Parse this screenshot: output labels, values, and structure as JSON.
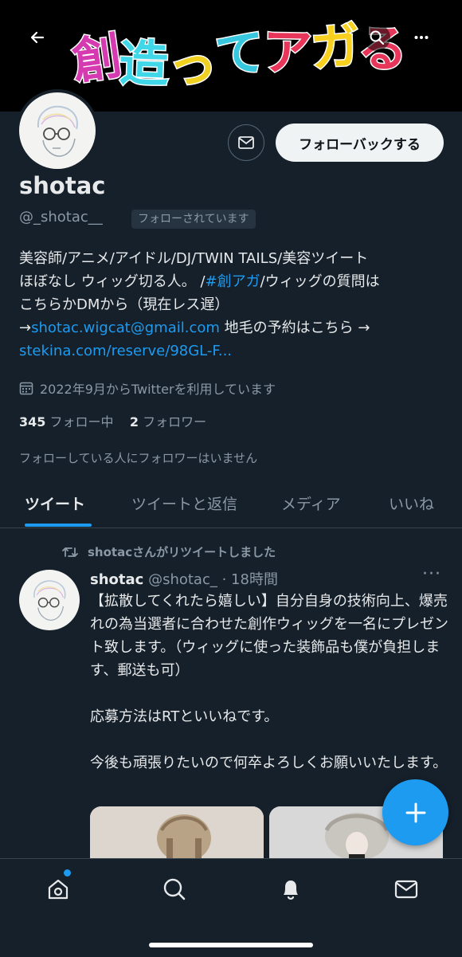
{
  "banner": {
    "title_glyphs": [
      "創",
      "造",
      "っ",
      "て",
      "ア",
      "ガ",
      "る"
    ]
  },
  "profile": {
    "display_name": "shotac",
    "handle": "@_shotac__",
    "follows_you_badge": "フォローされています",
    "follow_back_label": "フォローバックする",
    "bio": {
      "line1": "美容師/アニメ/アイドル/DJ/TWIN TAILS/美容ツイート",
      "line2_a": "ほぼなし ウィッグ切る人。 /",
      "hashtag": "#創アガ",
      "line2_b": "/ウィッグの質問は",
      "line3": "こちらかDMから（現在レス遅）",
      "arrow": "→",
      "email": "shotac.wigcat@gmail.com",
      "line4_b": " 地毛の予約はこちら →",
      "url": "stekina.com/reserve/98GL-F..."
    },
    "joined": "2022年9月からTwitterを利用しています",
    "following_count": "345",
    "following_label": "フォロー中",
    "followers_count": "2",
    "followers_label": "フォロワー",
    "mutuals_note": "フォローしている人にフォロワーはいません"
  },
  "tabs": [
    "ツイート",
    "ツイートと返信",
    "メディア",
    "いいね"
  ],
  "tweet": {
    "retweet_note": "shotacさんがリツイートしました",
    "author_name": "shotac",
    "author_handle": "@shotac_",
    "time": "· 18時間",
    "more": "···",
    "body": {
      "p1": "【拡散してくれたら嬉しい】自分自身の技術向上、爆売れの為当選者に合わせた創作ウィッグを一名にプレゼント致します。（ウィッグに使った装飾品も僕が負担します、郵送も可）",
      "p2": "応募方法はRTといいねです。",
      "p3": "今後も頑張りたいので何卒よろしくお願いいたします。"
    }
  },
  "fab_label": "+",
  "colors": {
    "accent": "#1d9bf0",
    "background": "#15202b",
    "text": "#e7e9ea",
    "muted": "#8b98a5"
  },
  "icons": [
    "back-arrow-icon",
    "search-icon",
    "more-icon",
    "mail-icon",
    "calendar-icon",
    "retweet-icon",
    "home-icon",
    "search-nav-icon",
    "bell-icon",
    "mail-nav-icon",
    "plus-icon"
  ]
}
